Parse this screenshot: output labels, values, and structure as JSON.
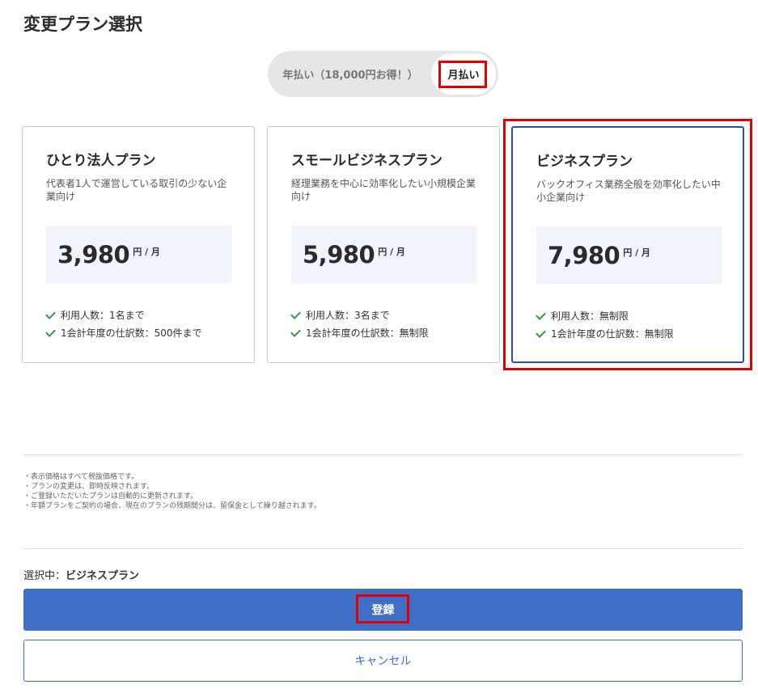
{
  "page": {
    "title": "変更プラン選択"
  },
  "billing_toggle": {
    "yearly_label": "年払い（18,000円お得！）",
    "monthly_label": "月払い",
    "selected": "monthly"
  },
  "plans": [
    {
      "name": "ひとり法人プラン",
      "description": "代表者1人で運営している取引の少ない企業向け",
      "price": "3,980",
      "unit": "円 / 月",
      "features": [
        "利用人数：1名まで",
        "1会計年度の仕訳数：500件まで"
      ],
      "selected": false
    },
    {
      "name": "スモールビジネスプラン",
      "description": "経理業務を中心に効率化したい小規模企業向け",
      "price": "5,980",
      "unit": "円 / 月",
      "features": [
        "利用人数：3名まで",
        "1会計年度の仕訳数：無制限"
      ],
      "selected": false
    },
    {
      "name": "ビジネスプラン",
      "description": "バックオフィス業務全般を効率化したい中小企業向け",
      "price": "7,980",
      "unit": "円 / 月",
      "features": [
        "利用人数：無制限",
        "1会計年度の仕訳数：無制限"
      ],
      "selected": true
    }
  ],
  "notes": [
    "・表示価格はすべて税抜価格です。",
    "・プランの変更は、即時反映されます。",
    "・ご登録いただいたプランは自動的に更新されます。",
    "・年額プランをご契約の場合、現在のプランの残期間分は、留保金として繰り越されます。"
  ],
  "selection": {
    "label": "選択中：",
    "value": "ビジネスプラン"
  },
  "actions": {
    "register_label": "登録",
    "cancel_label": "キャンセル"
  },
  "colors": {
    "primary": "#3f6ec6",
    "selected_border": "#2f4f9a",
    "annotation": "#e00000",
    "check": "#2e9b4e"
  }
}
